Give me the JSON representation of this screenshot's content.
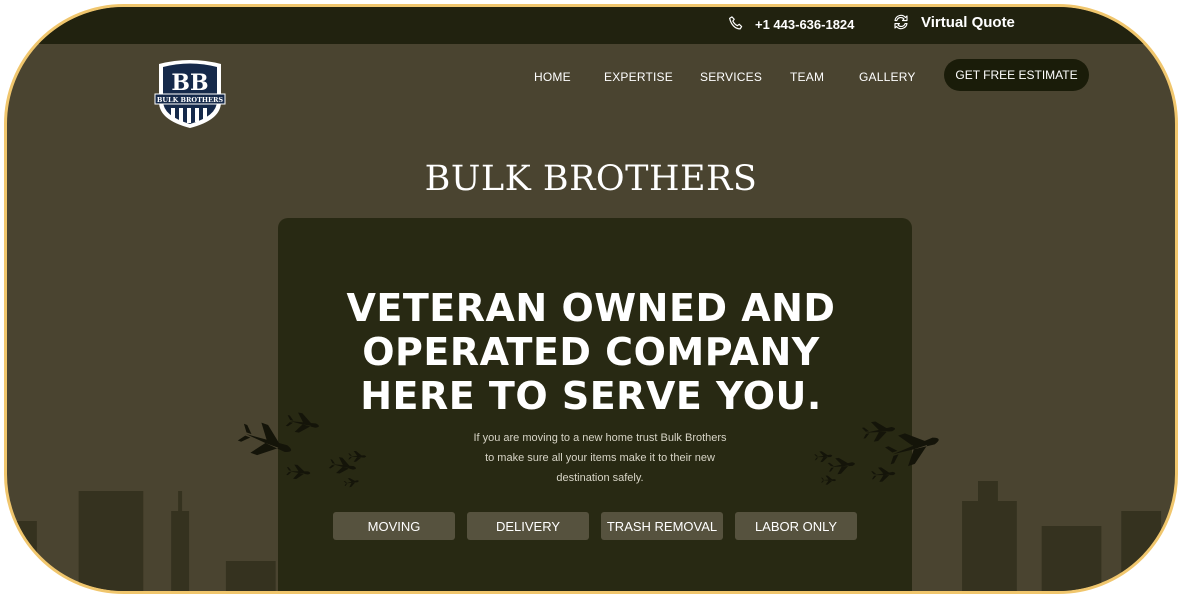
{
  "topbar": {
    "phone": "+1 443-636-1824",
    "quote": "Virtual Quote"
  },
  "logo": {
    "initials": "BB",
    "name": "BULK BROTHERS"
  },
  "nav": {
    "items": [
      "HOME",
      "EXPERTISE",
      "SERVICES",
      "TEAM",
      "GALLERY"
    ],
    "cta": "GET FREE ESTIMATE"
  },
  "hero": {
    "brand": "BULK BROTHERS",
    "headline_lines": [
      "VETERAN OWNED AND",
      "OPERATED COMPANY",
      "HERE TO SERVE YOU."
    ],
    "description_lines": [
      "If you are moving to a new home trust Bulk Brothers",
      "to make sure all your items make it to their new",
      "destination safely."
    ],
    "services": [
      "MOVING",
      "DELIVERY",
      "TRASH REMOVAL",
      "LABOR ONLY"
    ]
  },
  "icons": {
    "phone": "phone-icon",
    "quote": "refresh-icon",
    "planes": "airplane-icon"
  },
  "colors": {
    "background": "#4a4430",
    "topbar": "#21220f",
    "card": "#282913",
    "border": "#f0c66d",
    "button": "#56523e"
  }
}
